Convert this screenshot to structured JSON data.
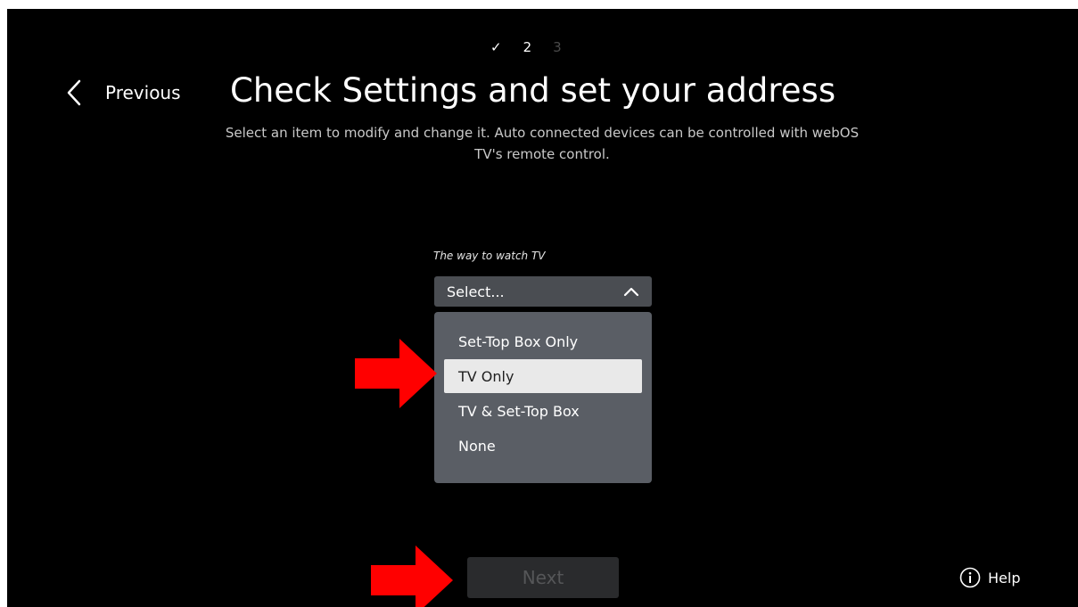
{
  "steps": {
    "step1": "✓",
    "step2": "2",
    "step3": "3"
  },
  "header": {
    "previous_label": "Previous",
    "title": "Check Settings and set your address",
    "subtitle_line1": "Select an item to modify and change it. Auto connected devices can be controlled with webOS",
    "subtitle_line2": "TV's remote control."
  },
  "field": {
    "label": "The way to watch TV",
    "value": "Select..."
  },
  "dropdown": {
    "options": [
      {
        "label": "Set-Top Box Only"
      },
      {
        "label": "TV Only"
      },
      {
        "label": "TV & Set-Top Box"
      },
      {
        "label": "None"
      }
    ],
    "focused_option": "TV Only"
  },
  "footer": {
    "next_label": "Next",
    "help_label": "Help"
  },
  "colors": {
    "background": "#000000",
    "select_bg": "#4a4d52",
    "dropdown_bg": "#5a5e65",
    "focused_bg": "#e9e9e9",
    "annotation_arrow": "#ff0000"
  },
  "icons": {
    "back": "chevron-left-icon",
    "select": "chevron-up-icon",
    "help": "info-circle-icon",
    "annotation": "red-arrow-icon"
  }
}
